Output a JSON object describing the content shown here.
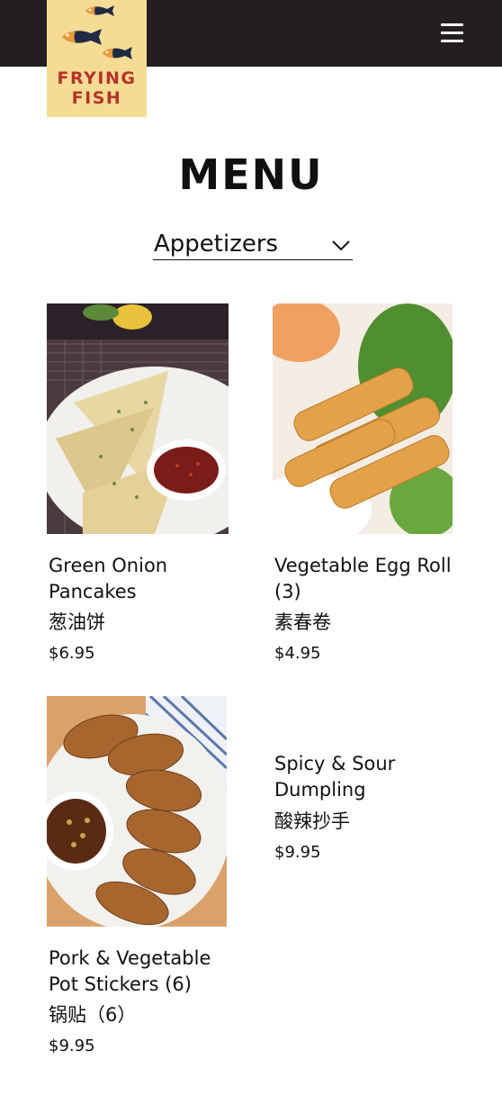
{
  "header": {
    "logo_line1": "FRYING",
    "logo_line2": "FISH",
    "brand_color": "#f5dc94",
    "logo_text_color": "#b5332a",
    "bar_color": "#231f20"
  },
  "page": {
    "title": "MENU"
  },
  "category": {
    "selected": "Appetizers"
  },
  "items": [
    {
      "name_line1": "Green Onion",
      "name_line2": "Pancakes",
      "chinese": "葱油饼",
      "price": "$6.95",
      "image": "green-onion-pancakes-photo"
    },
    {
      "name_line1": "Vegetable Egg Roll",
      "name_line2": "(3)",
      "chinese": "素春卷",
      "price": "$4.95",
      "image": "egg-roll-photo"
    },
    {
      "name_line1": "Pork & Vegetable",
      "name_line2": "Pot Stickers (6)",
      "chinese": "锅贴（6）",
      "price": "$9.95",
      "image": "pot-stickers-photo"
    },
    {
      "name_line1": "Spicy & Sour",
      "name_line2": "Dumpling",
      "chinese": "酸辣抄手",
      "price": "$9.95"
    }
  ]
}
